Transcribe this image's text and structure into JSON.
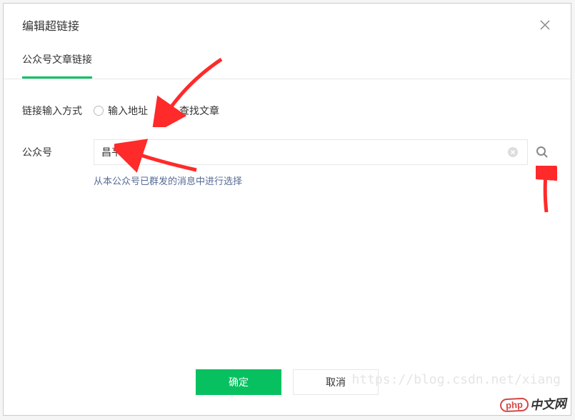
{
  "dialog": {
    "title": "编辑超链接",
    "tabs": [
      {
        "label": "公众号文章链接"
      }
    ],
    "input_mode": {
      "label": "链接输入方式",
      "options": [
        "输入地址",
        "查找文章"
      ],
      "selected_index": 1
    },
    "account_search": {
      "label": "公众号",
      "value": "昌平圈",
      "help_link": "从本公众号已群发的消息中进行选择"
    },
    "footer": {
      "confirm": "确定",
      "cancel": "取消"
    }
  },
  "watermark": "https://blog.csdn.net/xiang",
  "brand": {
    "php": "php",
    "cn": "中文网"
  }
}
